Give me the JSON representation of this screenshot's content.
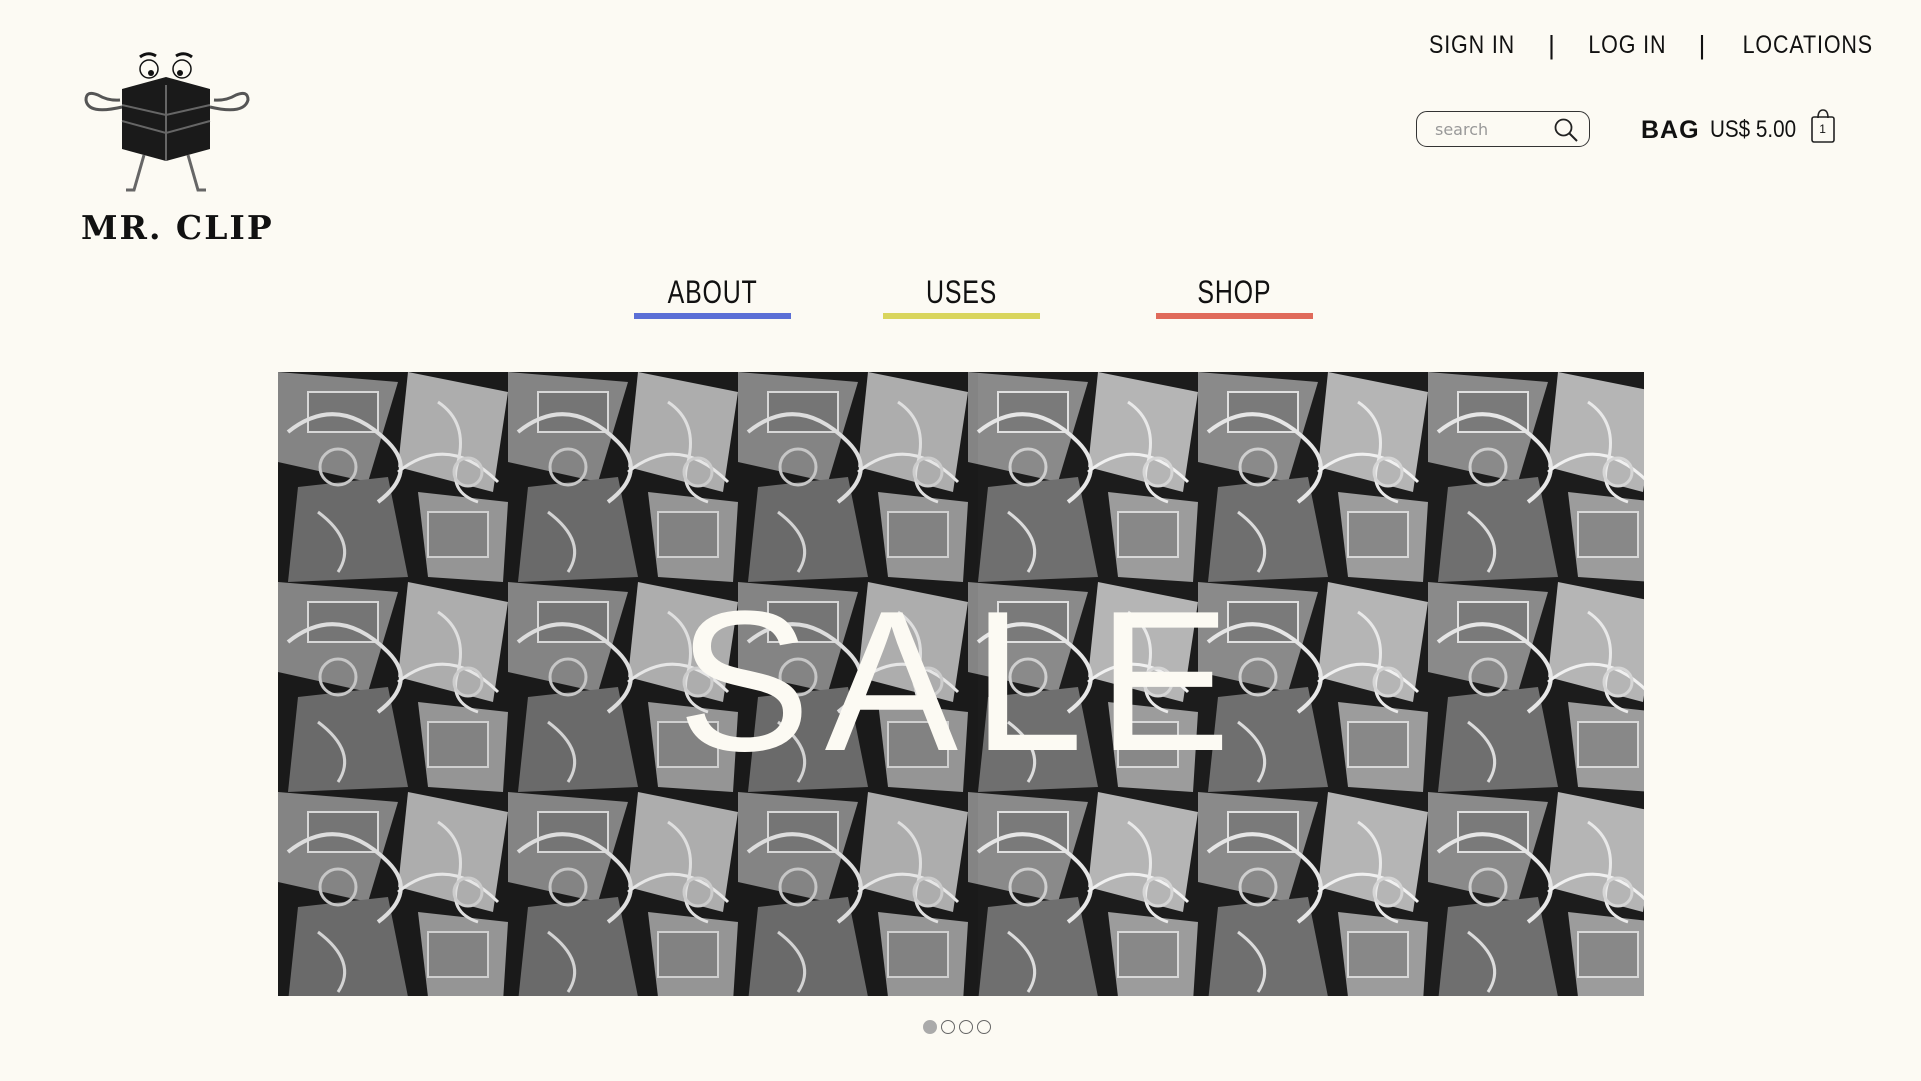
{
  "brand": {
    "name": "MR. CLIP",
    "logo_icon": "binder-clip-mascot-icon"
  },
  "top_links": {
    "sign_in": "SIGN IN",
    "separator": "|",
    "log_in": "LOG IN",
    "locations": "LOCATIONS"
  },
  "search": {
    "placeholder": "search",
    "value": "",
    "icon": "search-icon"
  },
  "bag": {
    "label": "BAG",
    "amount": "US$ 5.00",
    "count": "1",
    "icon": "shopping-bag-icon"
  },
  "nav": {
    "items": [
      {
        "label": "ABOUT",
        "color": "#5b6fd6"
      },
      {
        "label": "USES",
        "color": "#d9d55c"
      },
      {
        "label": "SHOP",
        "color": "#e06a5a"
      }
    ]
  },
  "hero": {
    "text": "SALE",
    "background": "binder-clips-photo",
    "slides_total": 4,
    "active_slide": 1
  },
  "colors": {
    "background": "#fcfaf3",
    "text": "#111111"
  }
}
